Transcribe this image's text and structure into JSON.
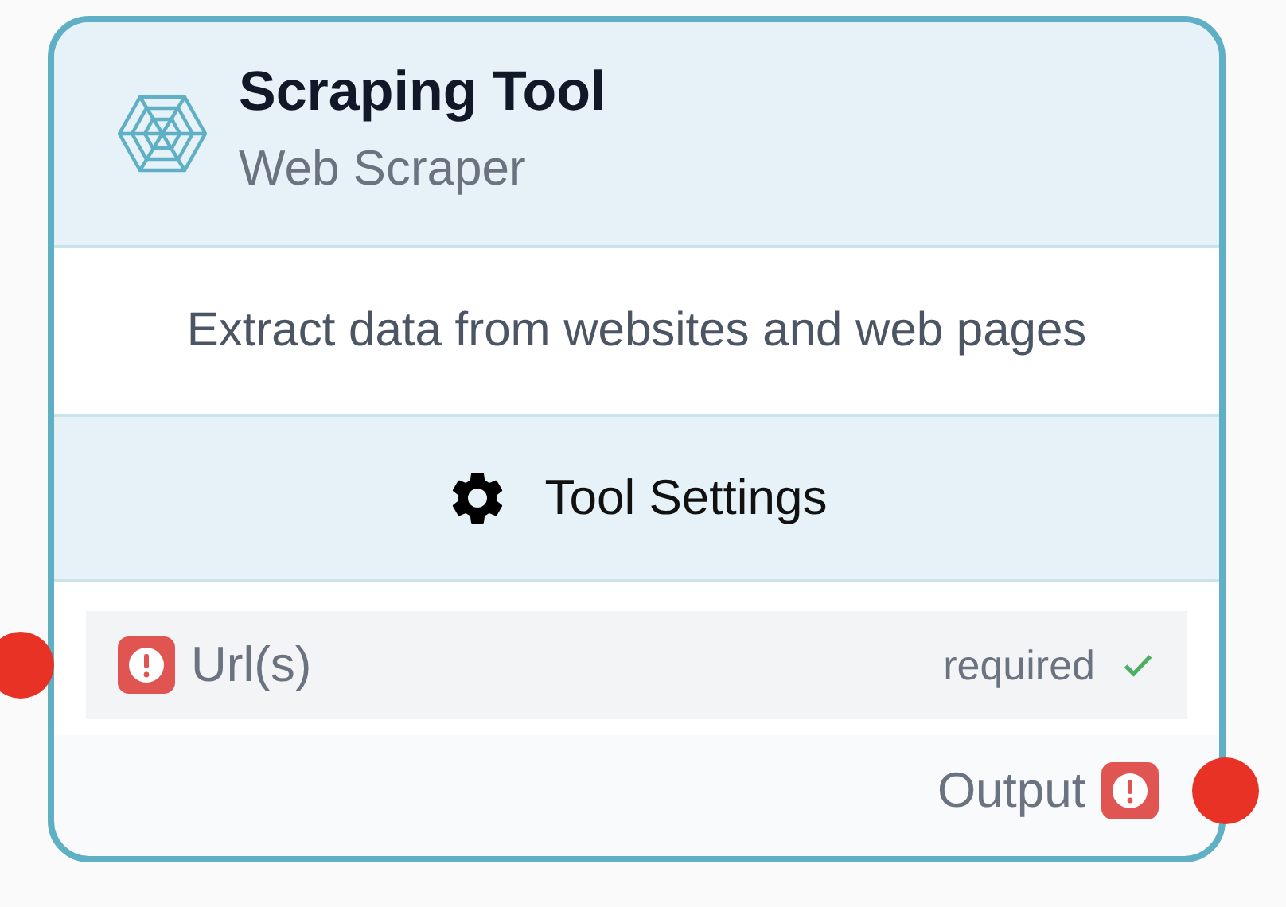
{
  "node": {
    "title": "Scraping Tool",
    "subtitle": "Web Scraper",
    "description": "Extract data from websites and web pages"
  },
  "settings_button": {
    "label": "Tool Settings"
  },
  "inputs": [
    {
      "label": "Url(s)",
      "error": true,
      "hint": "required",
      "satisfied": true
    }
  ],
  "outputs": [
    {
      "label": "Output",
      "error": true
    }
  ]
}
